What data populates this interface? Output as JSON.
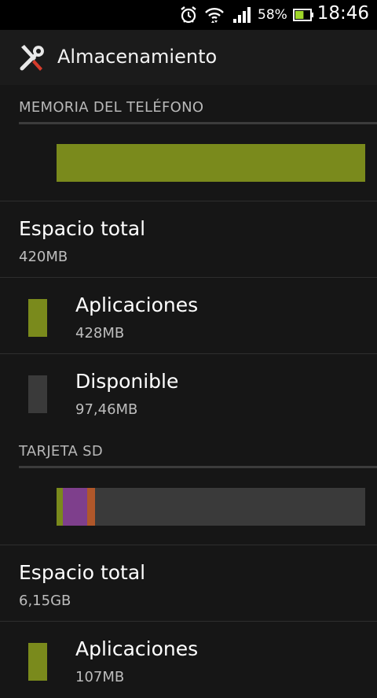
{
  "status_bar": {
    "icons": [
      "alarm-clock-icon",
      "wifi-icon",
      "cell-signal-icon",
      "battery-icon"
    ],
    "battery_percent": "58%",
    "battery_level": 0.58,
    "time": "18:46"
  },
  "action_bar": {
    "icon": "tools-icon",
    "title": "Almacenamiento"
  },
  "phone": {
    "header": "MEMORIA DEL TELÉFONO",
    "usage_segments": [
      {
        "name": "Aplicaciones",
        "fraction": 1.0,
        "color": "#7a8a1c"
      }
    ],
    "total": {
      "label": "Espacio total",
      "value": "420MB"
    },
    "categories": [
      {
        "label": "Aplicaciones",
        "value": "428MB",
        "color": "#7a8a1c"
      },
      {
        "label": "Disponible",
        "value": "97,46MB",
        "color": "#3a3a3a"
      }
    ]
  },
  "sd_card": {
    "header": "TARJETA SD",
    "usage_segments": [
      {
        "name": "Aplicaciones",
        "fraction": 0.02,
        "color": "#7a8a1c"
      },
      {
        "name": "segment-2",
        "fraction": 0.08,
        "color": "#7e3f8c"
      },
      {
        "name": "segment-3",
        "fraction": 0.025,
        "color": "#b0572a"
      },
      {
        "name": "Disponible",
        "fraction": 0.875,
        "color": "#3a3a3a"
      }
    ],
    "total": {
      "label": "Espacio total",
      "value": "6,15GB"
    },
    "categories": [
      {
        "label": "Aplicaciones",
        "value": "107MB",
        "color": "#7a8a1c"
      }
    ]
  }
}
